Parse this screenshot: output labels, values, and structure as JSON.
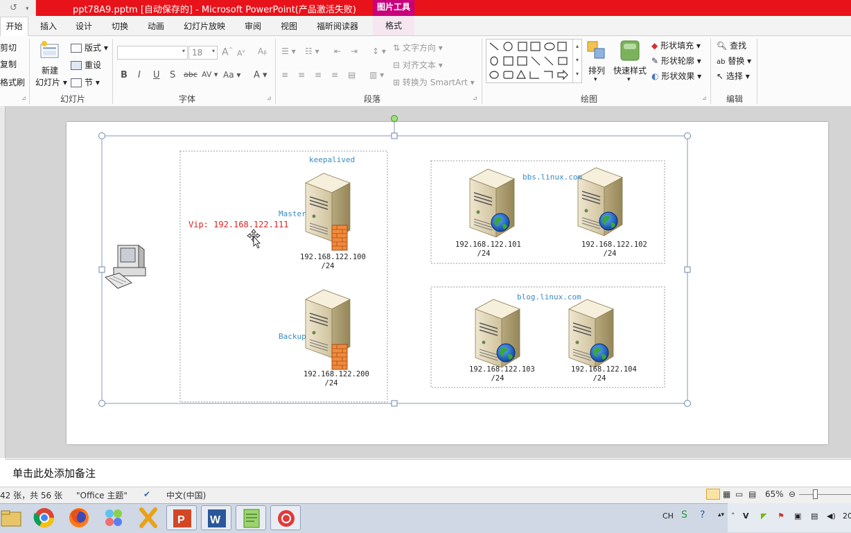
{
  "window": {
    "title": "ppt78A9.pptm [自动保存的]  -  Microsoft PowerPoint(产品激活失败)",
    "quick_access_undo": "↺",
    "context_tool_group": "图片工具"
  },
  "tabs": [
    "开始",
    "插入",
    "设计",
    "切换",
    "动画",
    "幻灯片放映",
    "审阅",
    "视图",
    "福昕阅读器",
    "格式"
  ],
  "ribbon": {
    "clipboard": {
      "cut": "剪切",
      "copy": "复制",
      "painter": "格式刷"
    },
    "slides": {
      "new_slide_1": "新建",
      "new_slide_2": "幻灯片",
      "layout": "版式",
      "reset": "重设",
      "section": "节",
      "group_label": "幻灯片"
    },
    "font": {
      "font_name": "",
      "font_size": "18",
      "group_label": "字体"
    },
    "paragraph": {
      "text_direction": "文字方向",
      "align_text": "对齐文本",
      "smartart": "转换为 SmartArt",
      "group_label": "段落"
    },
    "drawing": {
      "arrange": "排列",
      "quick_styles": "快速样式",
      "shape_fill": "形状填充",
      "shape_outline": "形状轮廓",
      "shape_effects": "形状效果",
      "group_label": "绘图"
    },
    "editing": {
      "find": "查找",
      "replace": "替换",
      "select": "选择",
      "group_label": "编辑"
    }
  },
  "slide": {
    "keepalived_label": "keepalived",
    "vip_label": "Vip: 192.168.122.111",
    "master_label": "Master",
    "backup_label": "Backup",
    "master_ip": [
      "192.168.122.100",
      "/24"
    ],
    "backup_ip": [
      "192.168.122.200",
      "/24"
    ],
    "bbs_domain": "bbs.linux.com",
    "blog_domain": "blog.linux.com",
    "web_servers": [
      [
        "192.168.122.101",
        "/24"
      ],
      [
        "192.168.122.102",
        "/24"
      ],
      [
        "192.168.122.103",
        "/24"
      ],
      [
        "192.168.122.104",
        "/24"
      ]
    ],
    "colors": {
      "vip": "#e02020",
      "label_blue": "#3a8ac4"
    }
  },
  "notes_placeholder": "单击此处添加备注",
  "status": {
    "slide_count": "42 张，共 56 张",
    "theme": "\"Office 主题\"",
    "language": "中文(中国)",
    "zoom": "65%",
    "zoom_fraction": 0.65
  },
  "taskbar": {
    "apps": [
      "file-explorer",
      "chrome",
      "firefox",
      "photo-app",
      "xshell",
      "powerpoint",
      "word",
      "notepad-plus",
      "snail-app"
    ],
    "tray_lang": "CH",
    "clock_partial": "20"
  }
}
